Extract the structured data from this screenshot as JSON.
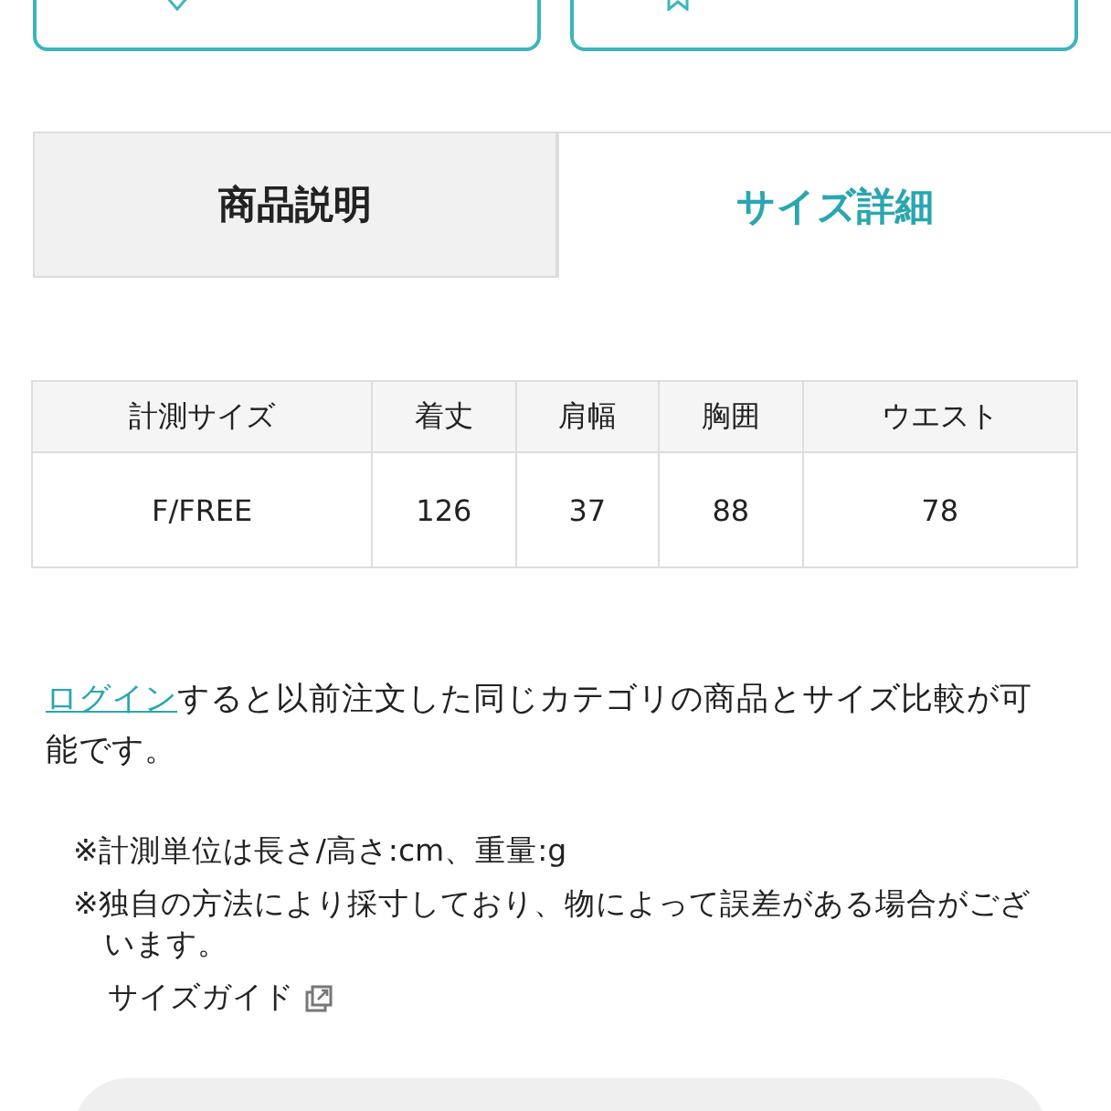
{
  "tabs": [
    {
      "label": "商品説明",
      "selected": false
    },
    {
      "label": "サイズ詳細",
      "selected": true
    }
  ],
  "size_table": {
    "columns": [
      "計測サイズ",
      "着丈",
      "肩幅",
      "胸囲",
      "ウエスト"
    ],
    "rows": [
      [
        "F/FREE",
        "126",
        "37",
        "88",
        "78"
      ]
    ]
  },
  "login_note": {
    "link": "ログイン",
    "text": "すると以前注文した同じカテゴリの商品とサイズ比較が可能です。"
  },
  "notes": [
    "※計測単位は長さ/高さ:cm、重量:g",
    "※独自の方法により採寸しており、物によって誤差がある場合がございます。"
  ],
  "size_guide_link": "サイズガイド"
}
